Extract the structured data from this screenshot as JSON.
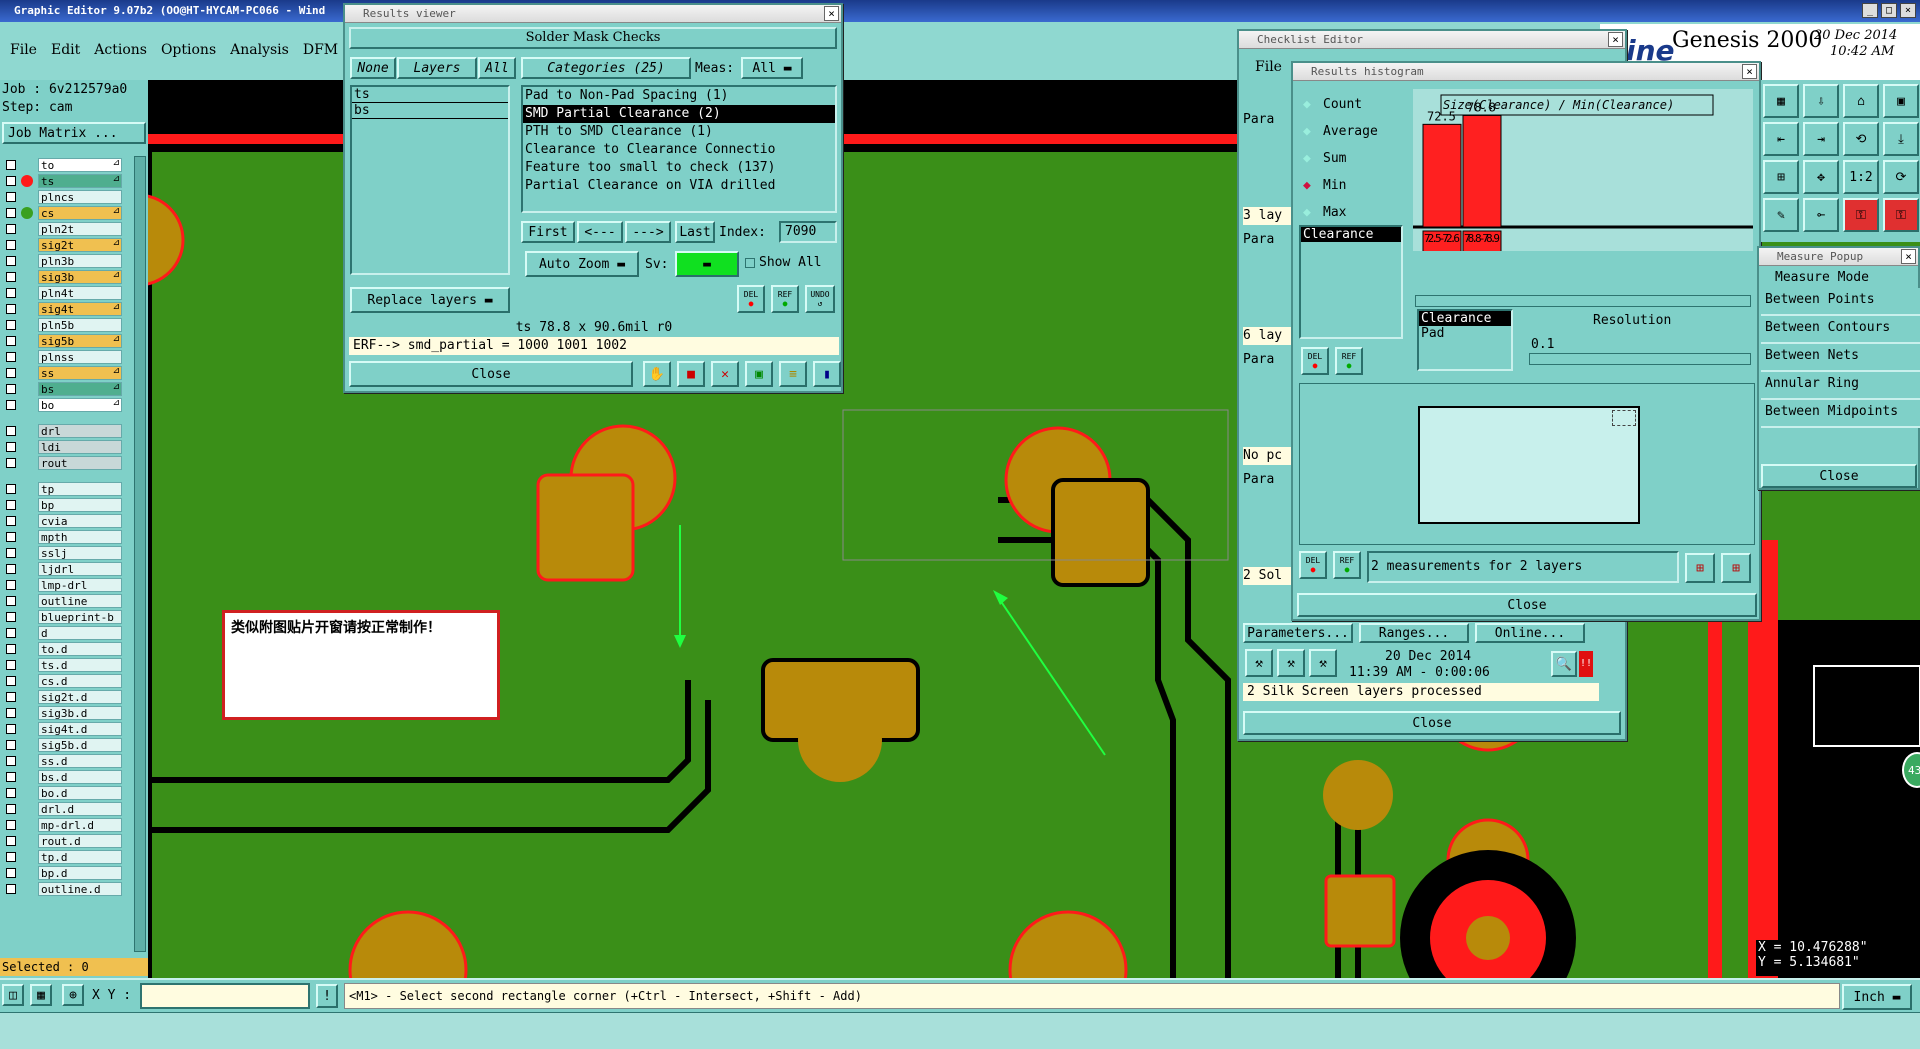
{
  "app": {
    "title": "Graphic Editor 9.07b2 (OO@HT-HYCAM-PC066 - Wind",
    "brand": "Genesis 2000",
    "date": "20 Dec 2014",
    "time": "10:42 AM",
    "brand_partial": "ine"
  },
  "menu": [
    "File",
    "Edit",
    "Actions",
    "Options",
    "Analysis",
    "DFM"
  ],
  "job": {
    "job": "Job : 6v212579a0",
    "step": "Step: cam",
    "matrix_btn": "Job Matrix ..."
  },
  "layers": [
    {
      "name": "to",
      "c": "w"
    },
    {
      "name": "ts",
      "c": "g"
    },
    {
      "name": "plncs",
      "c": ""
    },
    {
      "name": "cs",
      "c": "y"
    },
    {
      "name": "pln2t",
      "c": ""
    },
    {
      "name": "sig2t",
      "c": "y"
    },
    {
      "name": "pln3b",
      "c": ""
    },
    {
      "name": "sig3b",
      "c": "y"
    },
    {
      "name": "pln4t",
      "c": ""
    },
    {
      "name": "sig4t",
      "c": "y"
    },
    {
      "name": "pln5b",
      "c": ""
    },
    {
      "name": "sig5b",
      "c": "y"
    },
    {
      "name": "plnss",
      "c": ""
    },
    {
      "name": "ss",
      "c": "y"
    },
    {
      "name": "bs",
      "c": "g"
    },
    {
      "name": "bo",
      "c": "w"
    },
    {
      "name": "drl",
      "c": "gr"
    },
    {
      "name": "ldi",
      "c": "gr"
    },
    {
      "name": "rout",
      "c": "gr"
    },
    {
      "name": "tp",
      "c": ""
    },
    {
      "name": "bp",
      "c": ""
    },
    {
      "name": "cvia",
      "c": ""
    },
    {
      "name": "mpth",
      "c": ""
    },
    {
      "name": "sslj",
      "c": ""
    },
    {
      "name": "ljdrl",
      "c": ""
    },
    {
      "name": "lmp-drl",
      "c": ""
    },
    {
      "name": "outline",
      "c": ""
    },
    {
      "name": "blueprint-b",
      "c": ""
    },
    {
      "name": "d",
      "c": ""
    },
    {
      "name": "to.d",
      "c": ""
    },
    {
      "name": "ts.d",
      "c": ""
    },
    {
      "name": "cs.d",
      "c": ""
    },
    {
      "name": "sig2t.d",
      "c": ""
    },
    {
      "name": "sig3b.d",
      "c": ""
    },
    {
      "name": "sig4t.d",
      "c": ""
    },
    {
      "name": "sig5b.d",
      "c": ""
    },
    {
      "name": "ss.d",
      "c": ""
    },
    {
      "name": "bs.d",
      "c": ""
    },
    {
      "name": "bo.d",
      "c": ""
    },
    {
      "name": "drl.d",
      "c": ""
    },
    {
      "name": "mp-drl.d",
      "c": ""
    },
    {
      "name": "rout.d",
      "c": ""
    },
    {
      "name": "tp.d",
      "c": ""
    },
    {
      "name": "bp.d",
      "c": ""
    },
    {
      "name": "outline.d",
      "c": ""
    }
  ],
  "selected": "Selected : 0",
  "note": "类似附图贴片开窗请按正常制作！",
  "results_viewer": {
    "title": "Results viewer",
    "header": "Solder Mask Checks",
    "none": "None",
    "layers_tab": "Layers",
    "all": "All",
    "categories": "Categories (25)",
    "meas": "Meas:",
    "meas_val": "All",
    "layer_items": [
      "ts",
      "bs"
    ],
    "cat_items": [
      "Pad to Non-Pad Spacing (1)",
      "SMD Partial Clearance (2)",
      "PTH to SMD Clearance (1)",
      "Clearance to Clearance Connectio",
      "Feature too small to check (137)",
      "Partial Clearance on VIA drilled"
    ],
    "first": "First",
    "prev": "<---",
    "next": "--->",
    "last": "Last",
    "index_lbl": "Index:",
    "index_val": "7090",
    "auto_zoom": "Auto Zoom",
    "sv": "Sv:",
    "show_all": "Show All",
    "replace": "Replace layers",
    "del": "DEL",
    "ref": "REF",
    "undo": "UNDO",
    "status": "ts 78.8 x 90.6mil  r0",
    "erf": "ERF--> smd_partial = 1000 1001 1002",
    "close": "Close"
  },
  "checklist": {
    "title": "Checklist Editor",
    "file": "File",
    "rows": [
      "Para",
      "3 lay",
      "Para",
      "6 lay",
      "Para",
      "No pc",
      "Para",
      "2 Sol"
    ],
    "parameters": "Parameters...",
    "ranges": "Ranges...",
    "online": "Online...",
    "date": "20 Dec 2014",
    "time": "11:39 AM - 0:00:06",
    "status": "2 Silk Screen layers processed",
    "close": "Close"
  },
  "histogram": {
    "title": "Results histogram",
    "stats": [
      "Count",
      "Average",
      "Sum",
      "Min",
      "Max"
    ],
    "selected_stat": "Min",
    "list_item": "Clearance",
    "chart_title": "Size(Clearance) / Min(Clearance)",
    "clear_list": [
      "Clearance",
      "Pad"
    ],
    "resolution_lbl": "Resolution",
    "resolution_val": "0.1",
    "measurements": "2 measurements for 2 layers",
    "close": "Close",
    "del": "DEL",
    "ref": "REF"
  },
  "chart_data": {
    "type": "bar",
    "title": "Size(Clearance) / Min(Clearance)",
    "categories": [
      "72.5-72.6",
      "78.8-78.9"
    ],
    "values": [
      72.5,
      78.8
    ],
    "value_labels": [
      "72.5",
      "78.8"
    ],
    "colors": [
      "#ff2020",
      "#ff2020"
    ]
  },
  "measure": {
    "title": "Measure Popup",
    "mode": "Measure Mode",
    "items": [
      "Between Points",
      "Between Contours",
      "Between Nets",
      "Annular Ring",
      "Between Midpoints"
    ],
    "close": "Close",
    "x": "X = 10.476288\"",
    "y": "Y = 5.134681\""
  },
  "bottom": {
    "xy": "X Y :",
    "hint": "<M1> - Select second rectangle corner (+Ctrl - Intersect, +Shift - Add)",
    "units": "Inch"
  },
  "colors": {
    "board": "#3a8f18",
    "copper": "#b88a0a",
    "mask_edge": "#ff1a1a",
    "panel": "#7fd0c8"
  }
}
